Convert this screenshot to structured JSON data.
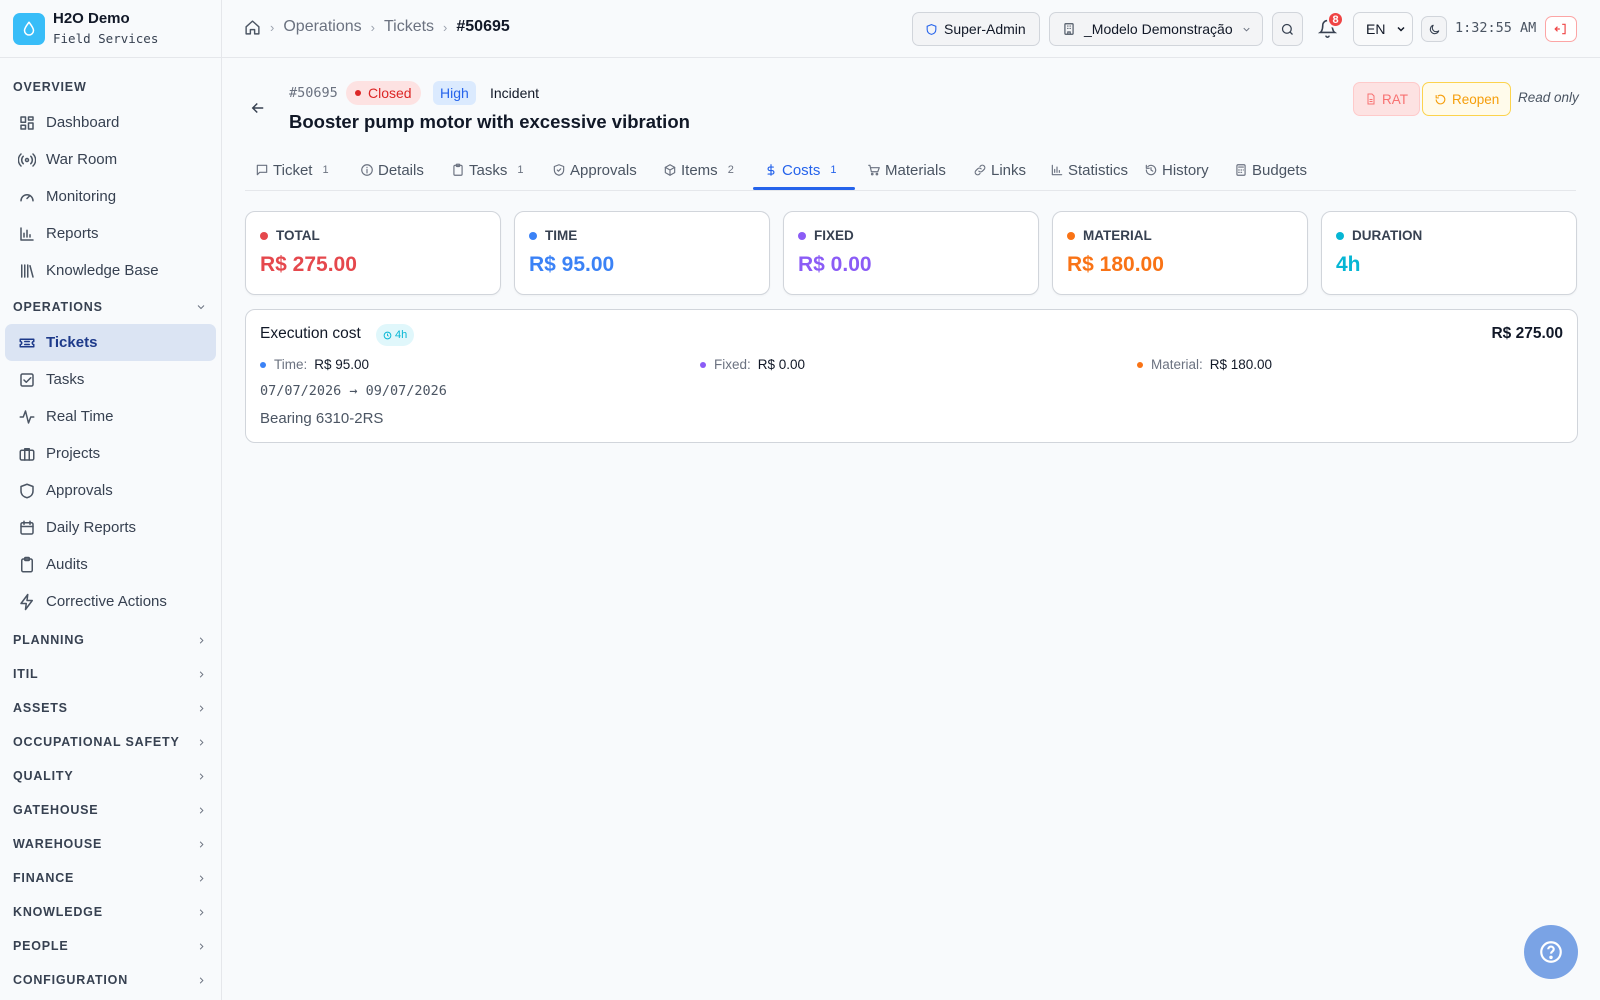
{
  "brand": {
    "name": "H2O Demo",
    "subtitle": "Field Services"
  },
  "sidebar": {
    "overview_label": "OVERVIEW",
    "overview_items": [
      {
        "label": "Dashboard",
        "icon": "grid-icon"
      },
      {
        "label": "War Room",
        "icon": "radio-icon"
      },
      {
        "label": "Monitoring",
        "icon": "gauge-icon"
      },
      {
        "label": "Reports",
        "icon": "bar-chart-icon"
      },
      {
        "label": "Knowledge Base",
        "icon": "library-icon"
      }
    ],
    "operations_label": "OPERATIONS",
    "operations_items": [
      {
        "label": "Tickets",
        "icon": "ticket-icon",
        "active": true
      },
      {
        "label": "Tasks",
        "icon": "check-square-icon"
      },
      {
        "label": "Real Time",
        "icon": "activity-icon"
      },
      {
        "label": "Projects",
        "icon": "briefcase-icon"
      },
      {
        "label": "Approvals",
        "icon": "shield-icon"
      },
      {
        "label": "Daily Reports",
        "icon": "calendar-icon"
      },
      {
        "label": "Audits",
        "icon": "clipboard-icon"
      },
      {
        "label": "Corrective Actions",
        "icon": "zap-icon"
      }
    ],
    "collapsed_sections": [
      "PLANNING",
      "ITIL",
      "ASSETS",
      "OCCUPATIONAL SAFETY",
      "QUALITY",
      "GATEHOUSE",
      "WAREHOUSE",
      "FINANCE",
      "KNOWLEDGE",
      "PEOPLE",
      "CONFIGURATION"
    ]
  },
  "header": {
    "breadcrumb": [
      "Operations",
      "Tickets",
      "#50695"
    ],
    "role": "Super-Admin",
    "tenant": "_Modelo Demonstração",
    "notifications": "8",
    "language": "EN",
    "clock": "1:32:55 AM"
  },
  "ticket": {
    "number": "#50695",
    "status": "Closed",
    "priority": "High",
    "type": "Incident",
    "title": "Booster pump motor with excessive vibration",
    "actions": {
      "rat": "RAT",
      "reopen": "Reopen",
      "readonly": "Read only"
    }
  },
  "tabs": [
    {
      "label": "Ticket",
      "count": "1",
      "icon": "message-square-icon"
    },
    {
      "label": "Details",
      "count": "",
      "icon": "info-icon"
    },
    {
      "label": "Tasks",
      "count": "1",
      "icon": "clipboard-icon"
    },
    {
      "label": "Approvals",
      "count": "",
      "icon": "shield-check-icon"
    },
    {
      "label": "Items",
      "count": "2",
      "icon": "package-icon"
    },
    {
      "label": "Costs",
      "count": "1",
      "icon": "dollar-icon",
      "active": true
    },
    {
      "label": "Materials",
      "count": "",
      "icon": "cart-icon"
    },
    {
      "label": "Links",
      "count": "",
      "icon": "link-icon"
    },
    {
      "label": "Statistics",
      "count": "",
      "icon": "bar-chart-icon"
    },
    {
      "label": "History",
      "count": "",
      "icon": "history-icon"
    },
    {
      "label": "Budgets",
      "count": "",
      "icon": "calculator-icon"
    }
  ],
  "summary_cards": [
    {
      "label": "TOTAL",
      "value": "R$ 275.00",
      "color": "#e5484d"
    },
    {
      "label": "TIME",
      "value": "R$ 95.00",
      "color": "#3b82f6"
    },
    {
      "label": "FIXED",
      "value": "R$ 0.00",
      "color": "#8b5cf6"
    },
    {
      "label": "MATERIAL",
      "value": "R$ 180.00",
      "color": "#f97316"
    },
    {
      "label": "DURATION",
      "value": "4h",
      "color": "#06b6d4"
    }
  ],
  "execution": {
    "title": "Execution cost",
    "duration": "4h",
    "total": "R$ 275.00",
    "breakdown": [
      {
        "label": "Time:",
        "value": "R$ 95.00",
        "color": "#3b82f6"
      },
      {
        "label": "Fixed:",
        "value": "R$ 0.00",
        "color": "#8b5cf6"
      },
      {
        "label": "Material:",
        "value": "R$ 180.00",
        "color": "#f97316"
      }
    ],
    "dates": "07/07/2026 → 09/07/2026",
    "item": "Bearing 6310-2RS"
  }
}
